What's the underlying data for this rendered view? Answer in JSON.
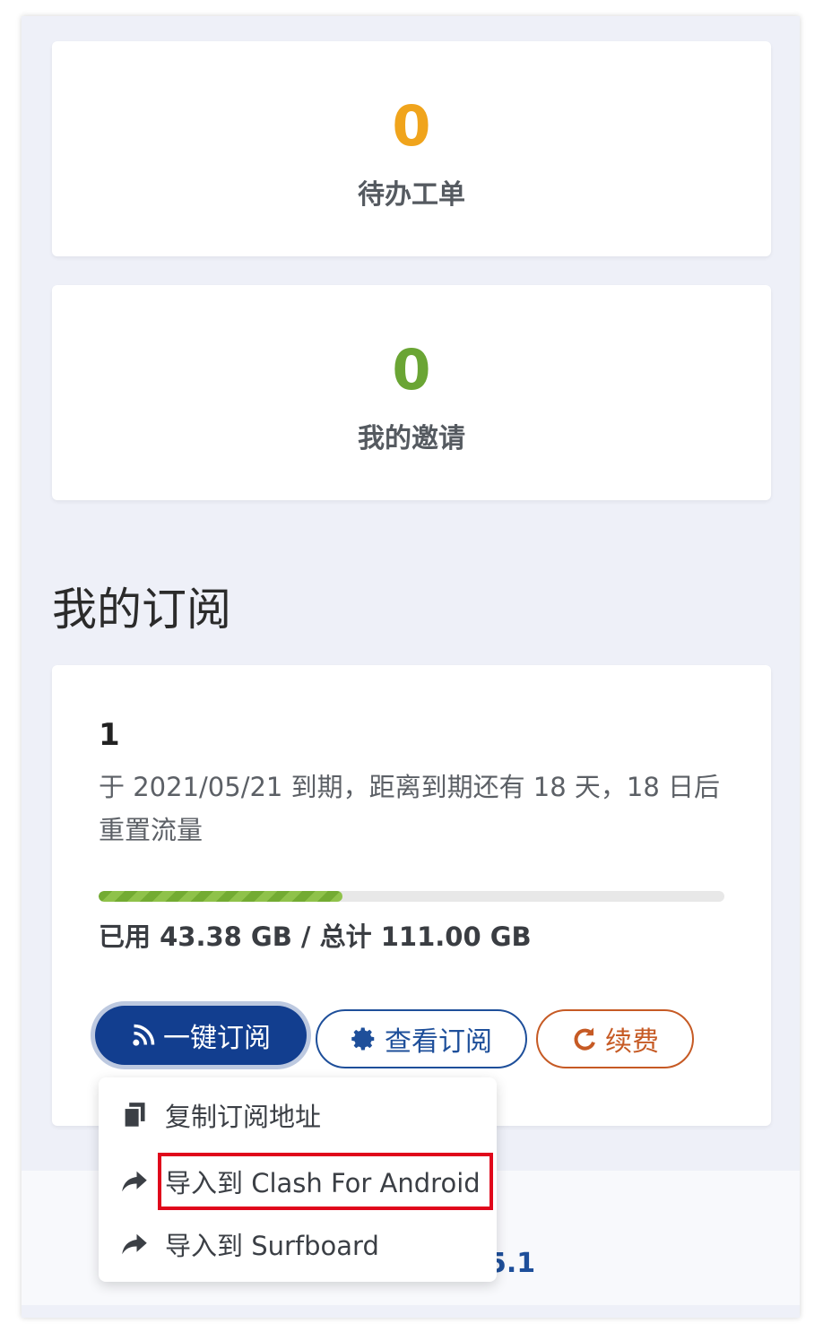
{
  "stats": {
    "tickets": {
      "value": "0",
      "label": "待办工单",
      "color": "#f0a41c"
    },
    "invites": {
      "value": "0",
      "label": "我的邀请",
      "color": "#6aa534"
    }
  },
  "subscription": {
    "section_title": "我的订阅",
    "plan_name": "1",
    "expiry_text": "于 2021/05/21 到期，距离到期还有 18 天，18 日后重置流量",
    "usage_text": "已用 43.38 GB / 总计 111.00 GB",
    "usage_fraction": 0.39,
    "buttons": {
      "one_click": {
        "label": "一键订阅",
        "icon": "rss-icon"
      },
      "view": {
        "label": "查看订阅",
        "icon": "gear-icon"
      },
      "renew": {
        "label": "续费",
        "icon": "refresh-icon"
      }
    }
  },
  "dropdown": {
    "items": [
      {
        "label": "复制订阅地址",
        "icon": "copy-icon"
      },
      {
        "label": "导入到 Clash For Android",
        "icon": "share-arrow-icon",
        "highlighted": true
      },
      {
        "label": "导入到 Surfboard",
        "icon": "share-arrow-icon"
      }
    ]
  },
  "footer": {
    "partial_text_1": ";",
    "partial_text_2": "5.1"
  },
  "colors": {
    "primary": "#123e8f",
    "highlight": "#e0071b",
    "renew": "#c65a24"
  }
}
